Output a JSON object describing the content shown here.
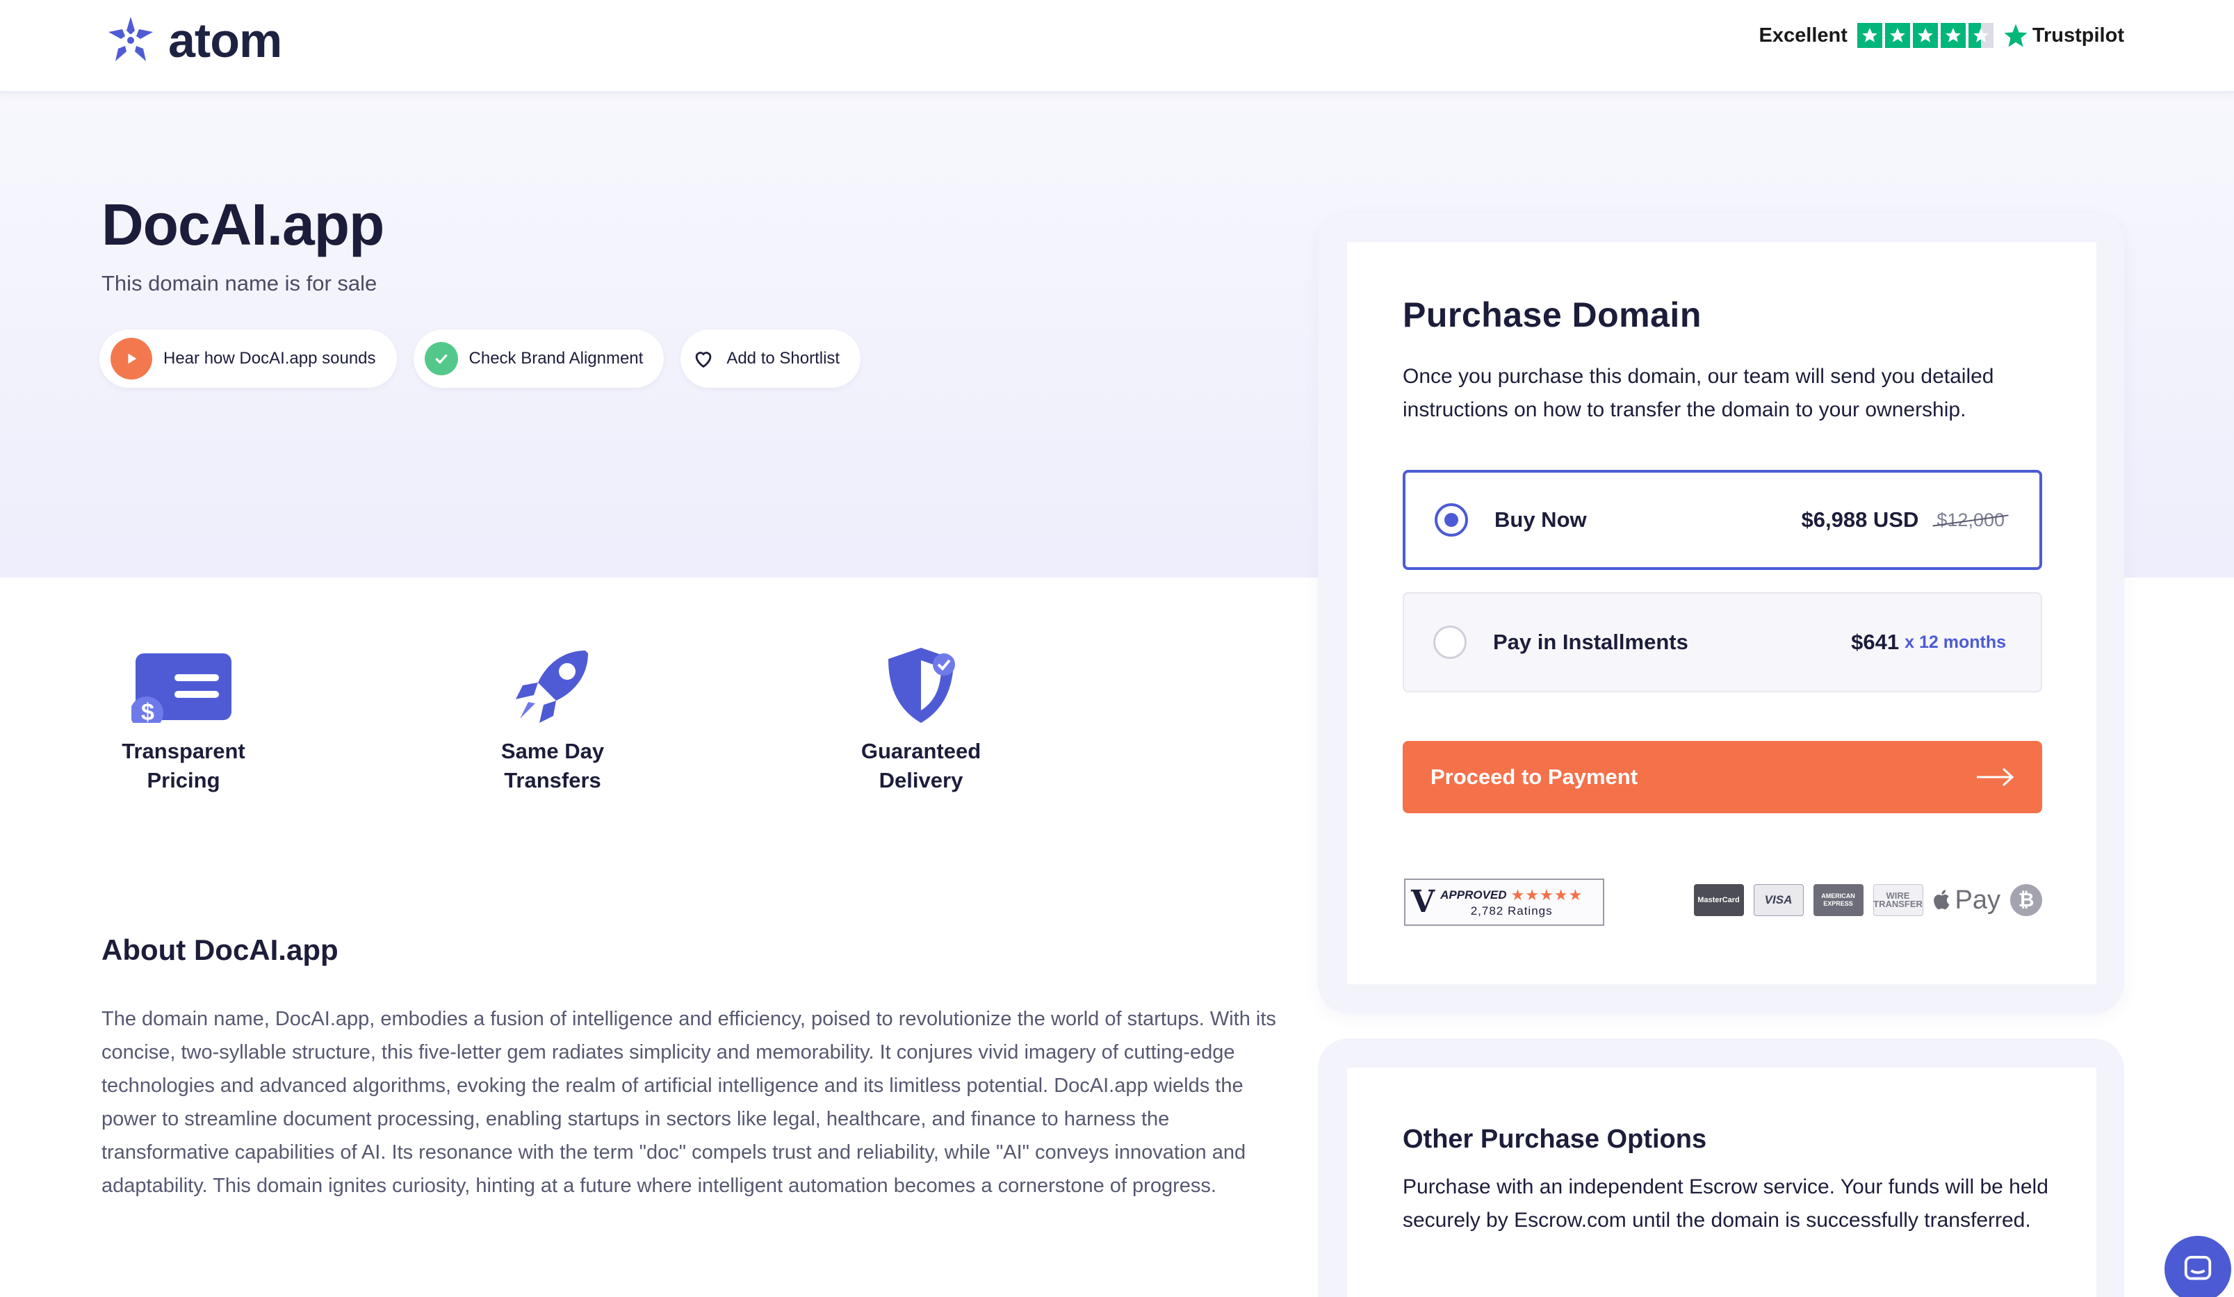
{
  "header": {
    "logo_text": "atom",
    "trust_label": "Excellent",
    "trust_brand": "Trustpilot",
    "trust_rating": 4.5
  },
  "hero": {
    "domain": "DocAI.app",
    "subtitle": "This domain name is for sale",
    "pills": [
      {
        "label": "Hear how DocAI.app sounds",
        "icon": "play-icon"
      },
      {
        "label": "Check Brand Alignment",
        "icon": "check-icon"
      },
      {
        "label": "Add to Shortlist",
        "icon": "heart-icon"
      }
    ]
  },
  "features": [
    {
      "label_line1": "Transparent",
      "label_line2": "Pricing",
      "icon": "pricing-card-icon"
    },
    {
      "label_line1": "Same Day",
      "label_line2": "Transfers",
      "icon": "rocket-icon"
    },
    {
      "label_line1": "Guaranteed",
      "label_line2": "Delivery",
      "icon": "shield-check-icon"
    }
  ],
  "about": {
    "title": "About DocAI.app",
    "text": "The domain name, DocAI.app, embodies a fusion of intelligence and efficiency, poised to revolutionize the world of startups. With its concise, two-syllable structure, this five-letter gem radiates simplicity and memorability. It conjures vivid imagery of cutting-edge technologies and advanced algorithms, evoking the realm of artificial intelligence and its limitless potential. DocAI.app wields the power to streamline document processing, enabling startups in sectors like legal, healthcare, and finance to harness the transformative capabilities of AI. Its resonance with the term \"doc\" compels trust and reliability, while \"AI\" conveys innovation and adaptability. This domain ignites curiosity, hinting at a future where intelligent automation becomes a cornerstone of progress."
  },
  "purchase": {
    "title": "Purchase Domain",
    "description": "Once you purchase this domain, our team will send you detailed instructions on how to transfer the domain to your ownership.",
    "options": [
      {
        "label": "Buy Now",
        "price": "$6,988 USD",
        "old_price": "$12,000",
        "selected": true
      },
      {
        "label": "Pay in Installments",
        "price": "$641",
        "installment": "x 12 months",
        "selected": false
      }
    ],
    "proceed_label": "Proceed to Payment",
    "shopper": {
      "mark": "V",
      "approved": "APPROVED",
      "stars": "★★★★★",
      "count": "2,782 Ratings"
    },
    "payments": {
      "mastercard": "MasterCard",
      "visa": "VISA",
      "amex": "AMERICAN EXPRESS",
      "wire": "WIRE TRANSFER",
      "applepay": "Pay",
      "bitcoin": "₿"
    }
  },
  "other": {
    "title": "Other Purchase Options",
    "description": "Purchase with an independent Escrow service. Your funds will be held securely by Escrow.com until the domain is successfully transferred."
  },
  "colors": {
    "accent": "#4c5bd4",
    "cta": "#f4714a",
    "trustpilot": "#00b67a",
    "text": "#1c1d3a"
  }
}
